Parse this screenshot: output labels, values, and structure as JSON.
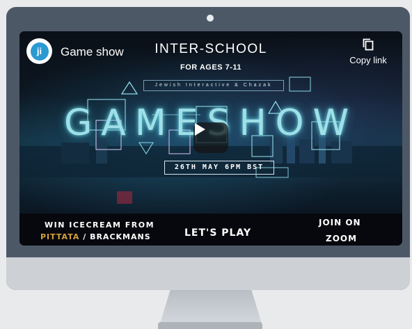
{
  "video": {
    "title": "Game show",
    "channel_logo_text": "ji",
    "copy_link_label": "Copy link",
    "icons": {
      "copy": "copy-icon",
      "play": "play-icon"
    }
  },
  "thumbnail": {
    "heading": "INTER-SCHOOL",
    "subheading": "FOR AGES 7-11",
    "banner": "Jewish Interactive & Chazak",
    "main_title": "GAMESHOW",
    "date": "26TH MAY 6PM BST"
  },
  "footer": {
    "win_line": "WIN ICECREAM FROM",
    "sponsor_1": "PITTATA",
    "separator": " / ",
    "sponsor_2": "BRACKMANS",
    "cta": "LET'S PLAY",
    "join_line": "JOIN ON",
    "platform": "ZOOM"
  },
  "colors": {
    "frame": "#4d5867",
    "chin": "#cdd1d6",
    "glow_text": "#9fdfe8",
    "sponsor_accent": "#d2a13a"
  }
}
